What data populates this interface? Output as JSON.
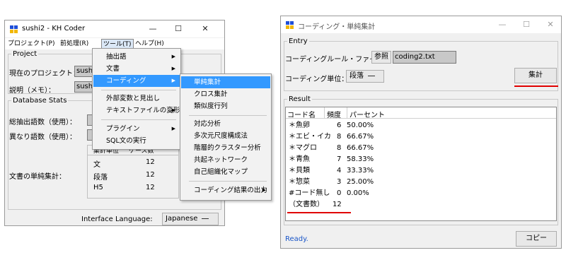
{
  "left_window": {
    "title": "sushi2 - KH Coder",
    "controls": {
      "minimize": "—",
      "maximize": "☐",
      "close": "✕"
    },
    "menubar": [
      "プロジェクト(P)",
      "前処理(R)",
      "ツール(T)",
      "ヘルプ(H)"
    ],
    "project": {
      "legend": "Project",
      "current_label": "現在のプロジェクト：",
      "current_value": "sush",
      "memo_label": "説明（メモ）：",
      "memo_value": "sush"
    },
    "stats": {
      "legend": "Database Stats",
      "total_label": "総抽出語数（使用）：",
      "distinct_label": "異なり語数（使用）：",
      "doc_label": "文書の単純集計：",
      "table_headers": [
        "集計単位",
        "ケース数"
      ],
      "table_rows": [
        {
          "unit": "文",
          "count": "12"
        },
        {
          "unit": "段落",
          "count": "12"
        },
        {
          "unit": "H5",
          "count": "12"
        }
      ]
    },
    "interface_language_label": "Interface Language:",
    "interface_language_value": "Japanese"
  },
  "tools_menu": {
    "items": [
      "抽出語",
      "文書",
      "コーディング",
      "外部変数と見出し",
      "テキストファイルの変形",
      "プラグイン",
      "SQL文の実行"
    ]
  },
  "coding_submenu": {
    "items": [
      "単純集計",
      "クロス集計",
      "類似度行列",
      "対応分析",
      "多次元尺度構成法",
      "階層的クラスター分析",
      "共起ネットワーク",
      "自己組織化マップ",
      "コーディング結果の出力"
    ]
  },
  "right_window": {
    "title": "コーディング・単純集計",
    "controls": {
      "minimize": "—",
      "maximize": "☐",
      "close": "✕"
    },
    "entry": {
      "legend": "Entry",
      "rule_file_label": "コーディングルール・ファイル：",
      "browse_button": "参照",
      "file_value": "coding2.txt",
      "unit_label": "コーディング単位：",
      "unit_value": "段落",
      "run_button": "集計"
    },
    "result": {
      "legend": "Result",
      "headers": [
        "コード名",
        "頻度",
        "パーセント"
      ],
      "rows": [
        {
          "code": "＊魚卵",
          "freq": "6",
          "pct": "50.00%"
        },
        {
          "code": "＊エビ・イカ",
          "freq": "8",
          "pct": "66.67%"
        },
        {
          "code": "＊マグロ",
          "freq": "8",
          "pct": "66.67%"
        },
        {
          "code": "＊青魚",
          "freq": "7",
          "pct": "58.33%"
        },
        {
          "code": "＊貝類",
          "freq": "4",
          "pct": "33.33%"
        },
        {
          "code": "＊惣菜",
          "freq": "3",
          "pct": "25.00%"
        },
        {
          "code": "#コード無し",
          "freq": "0",
          "pct": "0.00%"
        },
        {
          "code": "（文書数）",
          "freq": "12",
          "pct": ""
        }
      ]
    },
    "status": "Ready.",
    "copy_button": "コピー"
  },
  "colors": {
    "highlight": "#3399ff",
    "annotation_red": "#e00000",
    "status_blue": "#1a56c8",
    "window_bg": "#f0f0f0"
  }
}
